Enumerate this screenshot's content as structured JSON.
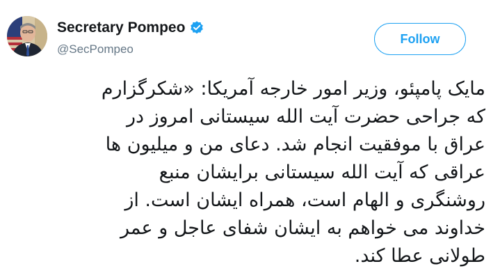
{
  "author": {
    "display_name": "Secretary Pompeo",
    "handle": "@SecPompeo",
    "verified_icon": "verified-badge-icon",
    "avatar_icon": "profile-photo"
  },
  "follow_button": {
    "label": "Follow"
  },
  "tweet": {
    "lines": [
      "مایک پامپئو، وزیر امور خارجه آمریکا: «شکرگزارم",
      "که جراحی حضرت آیت الله سیستانی امروز در",
      "عراق با موفقیت انجام شد. دعای من و میلیون ها",
      "عراقی که آیت الله سیستانی برایشان منبع",
      "روشنگری و الهام است، همراه ایشان است. از",
      "خداوند می خواهم به ایشان شفای عاجل و عمر",
      "طولانی عطا کند."
    ]
  },
  "colors": {
    "accent": "#1da1f2",
    "text": "#14171a",
    "secondary_text": "#657786"
  }
}
